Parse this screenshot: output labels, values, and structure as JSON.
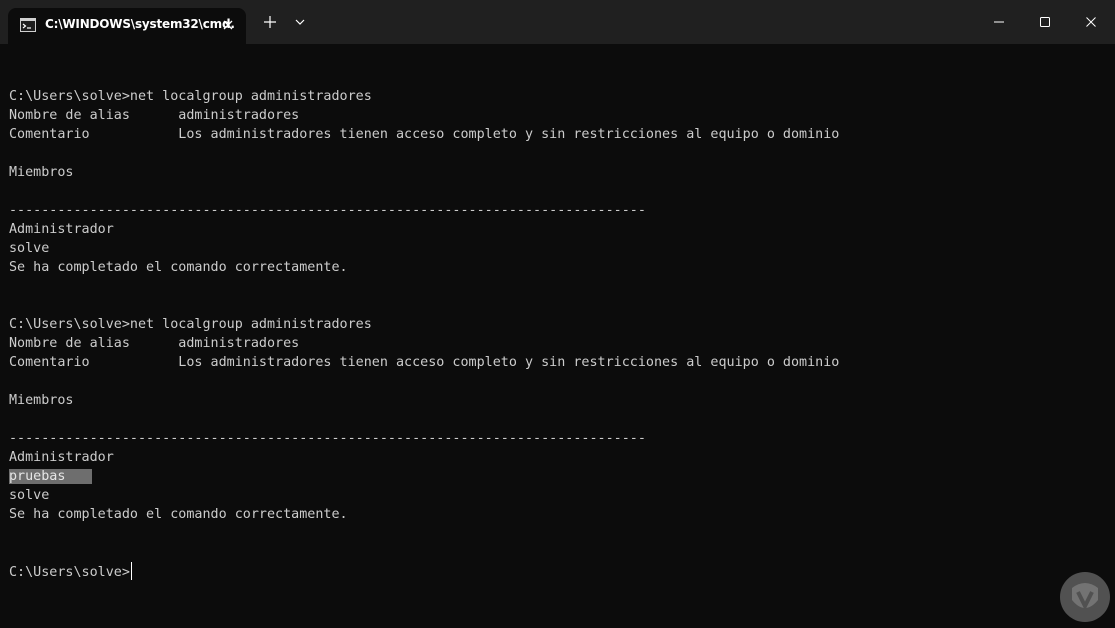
{
  "window": {
    "tab_title": "C:\\WINDOWS\\system32\\cmd.",
    "colors": {
      "titlebar": "#202020",
      "terminal_bg": "#0c0c0c",
      "text": "#cccccc",
      "selection": "#6e6e6e"
    }
  },
  "icons": {
    "tab_icon": "cmd-icon",
    "tab_close": "close-icon",
    "new_tab": "plus-icon",
    "dropdown": "chevron-down-icon",
    "minimize": "minimize-icon",
    "maximize": "maximize-icon",
    "close": "close-icon"
  },
  "terminal": {
    "lines": [
      "",
      "C:\\Users\\solve>net localgroup administradores",
      "Nombre de alias      administradores",
      "Comentario           Los administradores tienen acceso completo y sin restricciones al equipo o dominio",
      "",
      "Miembros",
      "",
      "-------------------------------------------------------------------------------",
      "Administrador",
      "solve",
      "Se ha completado el comando correctamente.",
      "",
      "",
      "C:\\Users\\solve>net localgroup administradores",
      "Nombre de alias      administradores",
      "Comentario           Los administradores tienen acceso completo y sin restricciones al equipo o dominio",
      "",
      "Miembros",
      "",
      "-------------------------------------------------------------------------------",
      "Administrador",
      "pruebas",
      "solve",
      "Se ha completado el comando correctamente.",
      "",
      "",
      "C:\\Users\\solve>"
    ],
    "selected_line_index": 21,
    "prompt_line_index": 26
  }
}
